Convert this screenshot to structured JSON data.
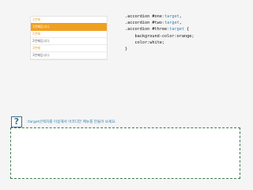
{
  "accordion": {
    "items": [
      {
        "title": "1번째",
        "content": "1번째입니다.",
        "active": true
      },
      {
        "title": "2번째",
        "content": "2번째입니다.",
        "active": false
      },
      {
        "title": "3번째",
        "content": "3번째입니다.",
        "active": false
      }
    ],
    "accent_color": "#f0a020"
  },
  "code": {
    "lines": [
      {
        "prefix": ".accordion #one",
        "pseudo": ":target",
        "suffix": ","
      },
      {
        "prefix": ".accordion #two",
        "pseudo": ":target",
        "suffix": ","
      },
      {
        "prefix": ".accordion #three",
        "pseudo": ":target",
        "suffix": " {"
      },
      {
        "prefix": "    background-color:orange;",
        "pseudo": "",
        "suffix": ""
      },
      {
        "prefix": "    color:white;",
        "pseudo": "",
        "suffix": ""
      },
      {
        "prefix": "}",
        "pseudo": "",
        "suffix": ""
      }
    ]
  },
  "task": {
    "icon": "question-mark-icon",
    "icon_glyph": "?",
    "text": ":target선택자를 이용해서 아코디언 메뉴를 만들어 보세요."
  }
}
